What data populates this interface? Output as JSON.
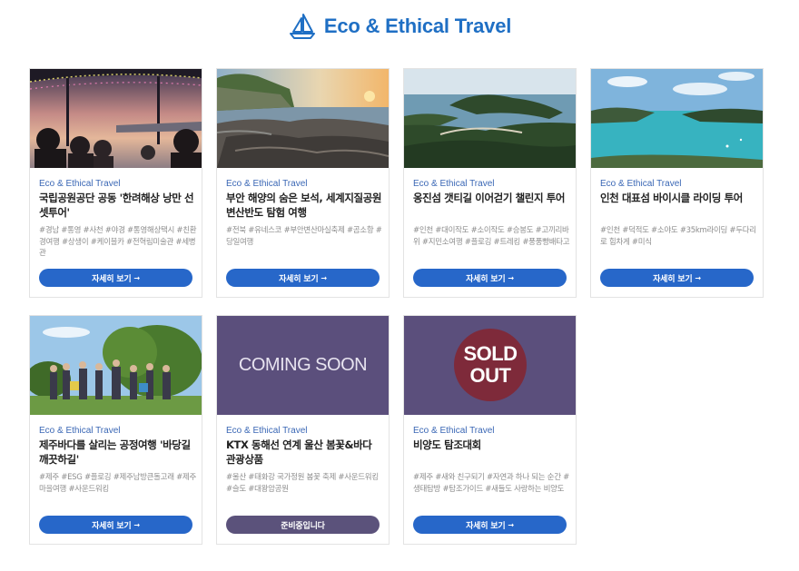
{
  "header": {
    "title": "Eco & Ethical Travel",
    "icon": "sailboat-icon",
    "accent": "#1f6fc4"
  },
  "cards": [
    {
      "category": "Eco & Ethical Travel",
      "title": "국립공원공단 공동 '한려해상 낭만 선셋투어'",
      "tags": "#경남 #통영 #사천 #야경 #통영해상택시 #친환경여행 #상생이 #케이블카 #전혁림미술관 #세병관",
      "button": "자세히 보기",
      "image": "sunset-boat-tour-photo"
    },
    {
      "category": "Eco & Ethical Travel",
      "title": "부안 해양의 숨은 보석, 세계지질공원 변산반도 탐험 여행",
      "tags": "#전북 #유네스코 #부안변산마실축제 #곰소항 #당일여행",
      "button": "자세히 보기",
      "image": "rocky-coast-photo"
    },
    {
      "category": "Eco & Ethical Travel",
      "title": "옹진섬 갯티길 이어걷기 챌린지 투어",
      "tags": "#인천 #대이작도 #소이작도 #승봉도 #고끼리바위 #지민소여행 #플로깅 #트레킹 #풍풍빵배타고",
      "button": "자세히 보기",
      "image": "island-aerial-photo"
    },
    {
      "category": "Eco & Ethical Travel",
      "title": "인천 대표섬 바이시클 라이딩 투어",
      "tags": "#인천 #덕적도 #소야도 #35km라이딩 #두다리로 힘차게 #미식",
      "button": "자세히 보기",
      "image": "turquoise-bay-photo"
    },
    {
      "category": "Eco & Ethical Travel",
      "title": "제주바다를 살리는 공정여행 '바당길 깨끗하길'",
      "tags": "#제주 #ESG #플로깅 #제주남방큰돌고래 #제주마을여행 #사운드워킹",
      "button": "자세히 보기",
      "image": "group-under-tree-photo"
    },
    {
      "category": "Eco & Ethical Travel",
      "title": "KTX 동해선 연계 울산 봄꽃&바다 관광상품",
      "tags": "#울산 #태화강 국가정원 봄꽃 축제 #사운드워킹 #슬도 #대왕암공원",
      "button": "준비중입니다",
      "image": "coming-soon-banner",
      "banner_text": "COMING SOON"
    },
    {
      "category": "Eco & Ethical Travel",
      "title": "비양도 탐조대회",
      "tags": "#제주 #새와 친구되기 #자연과 하나 되는 순간 #생태탐방 #탐조가이드 #새들도 사랑하는 비양도",
      "button": "자세히 보기",
      "image": "sold-out-banner",
      "banner_line1": "SOLD",
      "banner_line2": "OUT"
    }
  ],
  "colors": {
    "button_active": "#2767c9",
    "button_disabled": "#5b527b",
    "banner_bg": "#5b4f7c",
    "sold_disc": "#7e2a3a",
    "category_text": "#3a67b5"
  }
}
